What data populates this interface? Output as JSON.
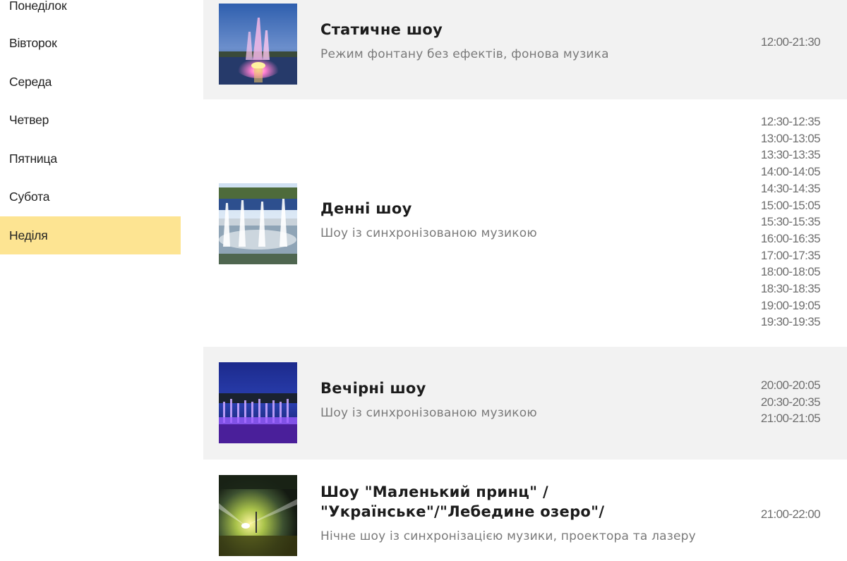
{
  "sidebar": {
    "days": [
      {
        "label": "Понеділок",
        "active": false
      },
      {
        "label": "Вівторок",
        "active": false
      },
      {
        "label": "Середа",
        "active": false
      },
      {
        "label": "Четвер",
        "active": false
      },
      {
        "label": "Пятница",
        "active": false
      },
      {
        "label": "Субота",
        "active": false
      },
      {
        "label": "Неділя",
        "active": true
      }
    ],
    "active_color": "#fde492"
  },
  "shows": [
    {
      "title": "Статичне шоу",
      "description": "Режим фонтану без ефектів, фонова музика",
      "times": [
        "12:00-21:30"
      ],
      "image": "fountain-static-photo"
    },
    {
      "title": "Денні шоу",
      "description": "Шоу із синхронізованою музикою",
      "times": [
        "12:30-12:35",
        "13:00-13:05",
        "13:30-13:35",
        "14:00-14:05",
        "14:30-14:35",
        "15:00-15:05",
        "15:30-15:35",
        "16:00-16:35",
        "17:00-17:35",
        "18:00-18:05",
        "18:30-18:35",
        "19:00-19:05",
        "19:30-19:35"
      ],
      "image": "fountain-day-photo"
    },
    {
      "title": "Вечірні шоу",
      "description": "Шоу із синхронізованою музикою",
      "times": [
        "20:00-20:05",
        "20:30-20:35",
        "21:00-21:05"
      ],
      "image": "fountain-evening-photo"
    },
    {
      "title": "Шоу \"Маленький принц\" / \"Українське\"/\"Лебедине озеро\"/",
      "title_line1": "Шоу \"Маленький принц\" /",
      "title_line2": "\"Українське\"/\"Лебедине озеро\"/",
      "description": "Нічне шоу із синхронізацією музики, проектора та лазеру",
      "times": [
        "21:00-22:00"
      ],
      "image": "fountain-night-laser-photo"
    }
  ],
  "colors": {
    "row_shade": "#f2f2f2",
    "title": "#1c1c1c",
    "description": "#7a7a7a",
    "times": "#6e6e6e"
  }
}
